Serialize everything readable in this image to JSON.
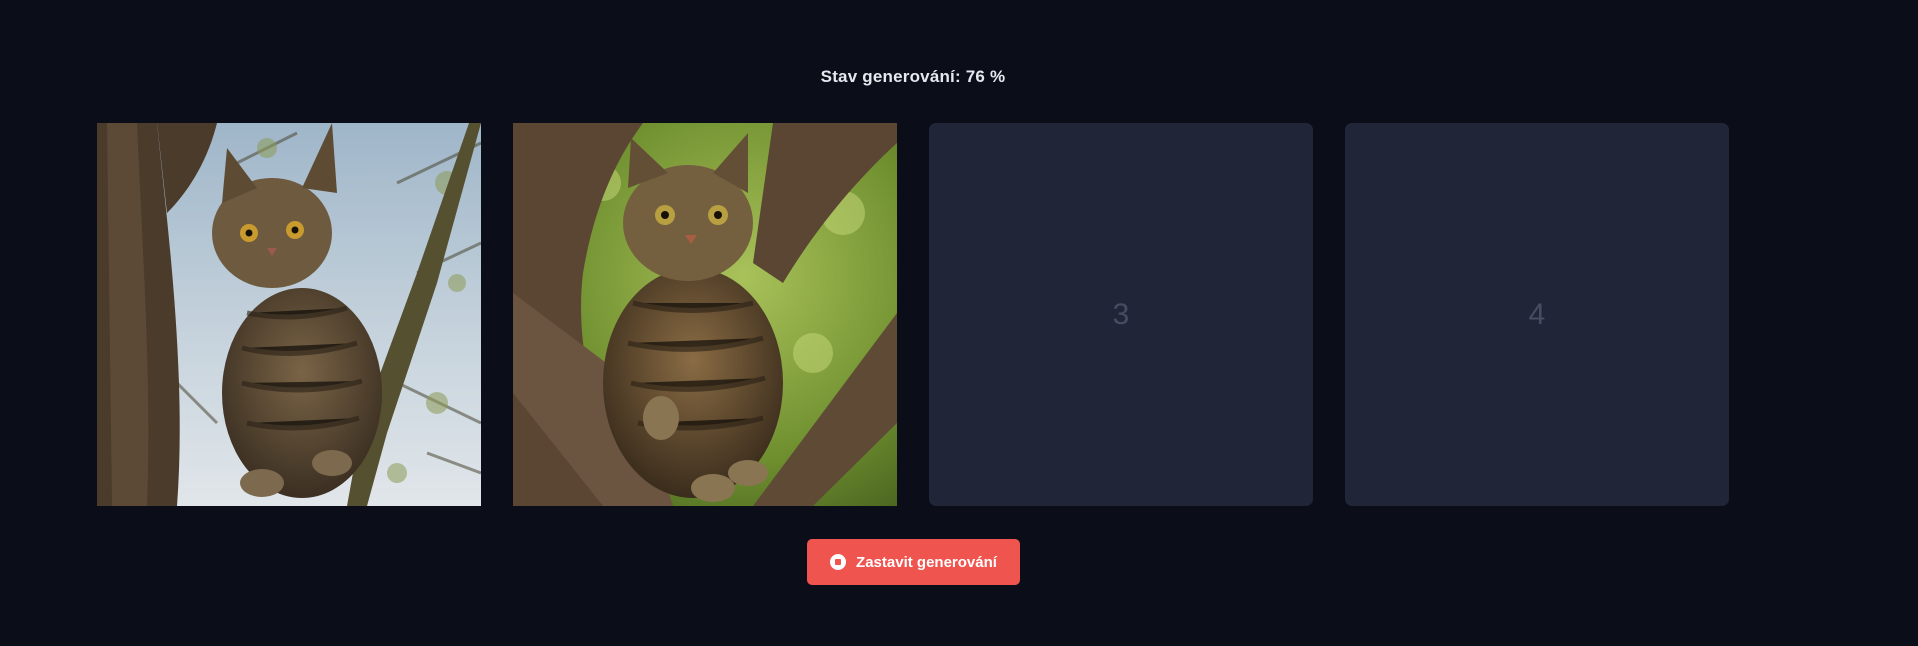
{
  "status": {
    "text": "Stav generování: 76 %",
    "progress_percent": 76
  },
  "tiles": [
    {
      "kind": "image",
      "description_icon": "cat-image"
    },
    {
      "kind": "image",
      "description_icon": "cat-image"
    },
    {
      "kind": "placeholder",
      "label": "3"
    },
    {
      "kind": "placeholder",
      "label": "4"
    }
  ],
  "actions": {
    "stop_label": "Zastavit generování",
    "stop_icon": "stop-circle-icon"
  },
  "colors": {
    "background": "#0b0e19",
    "tile_placeholder": "#212538",
    "accent": "#f0544f"
  }
}
